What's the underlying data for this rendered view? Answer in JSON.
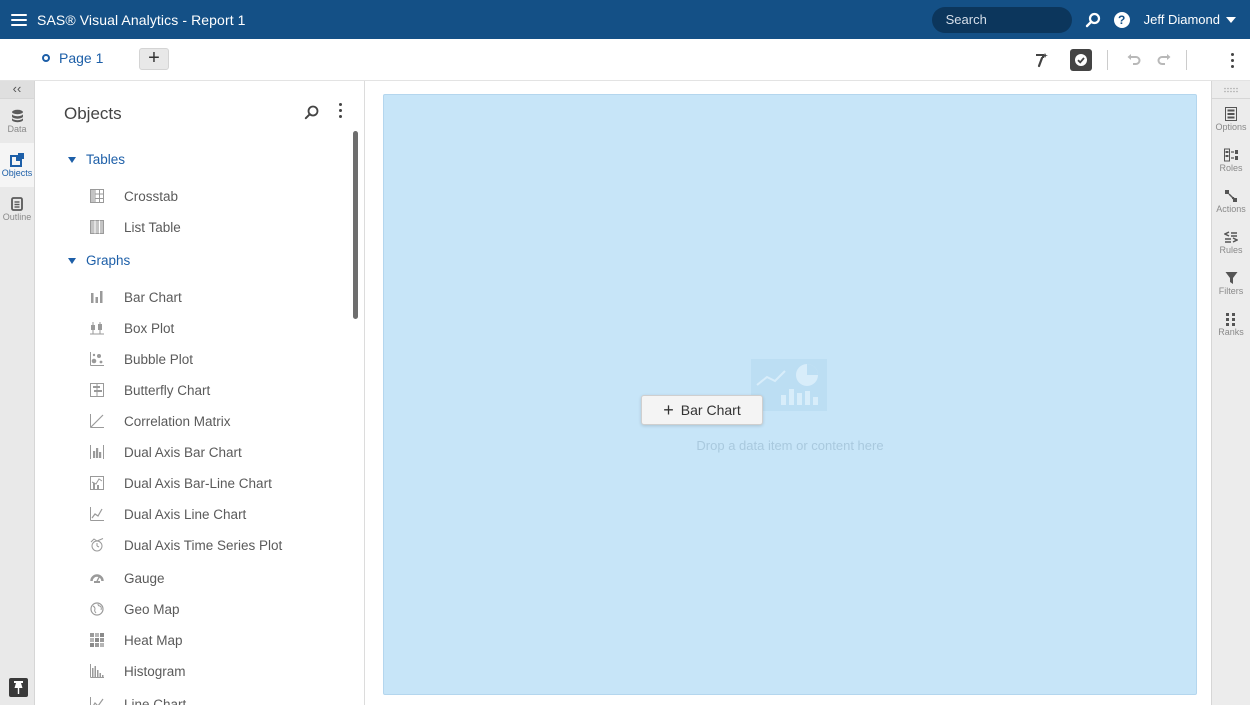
{
  "app": {
    "title": "SAS® Visual Analytics - Report 1"
  },
  "header": {
    "search_placeholder": "Search",
    "user_name": "Jeff Diamond",
    "help_glyph": "?"
  },
  "page_tabs": {
    "tabs": [
      {
        "label": "Page 1"
      }
    ],
    "add_label": "+"
  },
  "left_rail": {
    "collapse_label": "‹‹",
    "items": [
      {
        "label": "Data",
        "icon": "database-icon"
      },
      {
        "label": "Objects",
        "icon": "objects-icon",
        "active": true
      },
      {
        "label": "Outline",
        "icon": "outline-icon"
      }
    ]
  },
  "objects_panel": {
    "title": "Objects",
    "groups": [
      {
        "label": "Tables",
        "items": [
          {
            "label": "Crosstab",
            "icon": "crosstab-icon"
          },
          {
            "label": "List Table",
            "icon": "list-table-icon"
          }
        ]
      },
      {
        "label": "Graphs",
        "items": [
          {
            "label": "Bar Chart",
            "icon": "bar-chart-icon"
          },
          {
            "label": "Box Plot",
            "icon": "box-plot-icon"
          },
          {
            "label": "Bubble Plot",
            "icon": "bubble-plot-icon"
          },
          {
            "label": "Butterfly Chart",
            "icon": "butterfly-chart-icon"
          },
          {
            "label": "Correlation Matrix",
            "icon": "correlation-matrix-icon"
          },
          {
            "label": "Dual Axis Bar Chart",
            "icon": "dual-axis-bar-chart-icon"
          },
          {
            "label": "Dual Axis Bar-Line Chart",
            "icon": "dual-axis-bar-line-chart-icon"
          },
          {
            "label": "Dual Axis Line Chart",
            "icon": "dual-axis-line-chart-icon"
          },
          {
            "label": "Dual Axis Time Series Plot",
            "icon": "dual-axis-time-series-icon"
          },
          {
            "label": "Gauge",
            "icon": "gauge-icon"
          },
          {
            "label": "Geo Map",
            "icon": "geo-map-icon"
          },
          {
            "label": "Heat Map",
            "icon": "heat-map-icon"
          },
          {
            "label": "Histogram",
            "icon": "histogram-icon"
          },
          {
            "label": "Line Chart",
            "icon": "line-chart-icon"
          }
        ]
      }
    ]
  },
  "canvas": {
    "chip_label": "Bar Chart",
    "chip_plus": "+",
    "drop_text": "Drop a data item or content here"
  },
  "right_rail": {
    "items": [
      {
        "label": "Options",
        "icon": "options-icon"
      },
      {
        "label": "Roles",
        "icon": "roles-icon"
      },
      {
        "label": "Actions",
        "icon": "actions-icon"
      },
      {
        "label": "Rules",
        "icon": "rules-icon"
      },
      {
        "label": "Filters",
        "icon": "filter-icon"
      },
      {
        "label": "Ranks",
        "icon": "ranks-icon"
      }
    ]
  },
  "colors": {
    "header_bg": "#145086",
    "accent": "#1d5fa8",
    "drop_zone": "#c7e5f8"
  }
}
